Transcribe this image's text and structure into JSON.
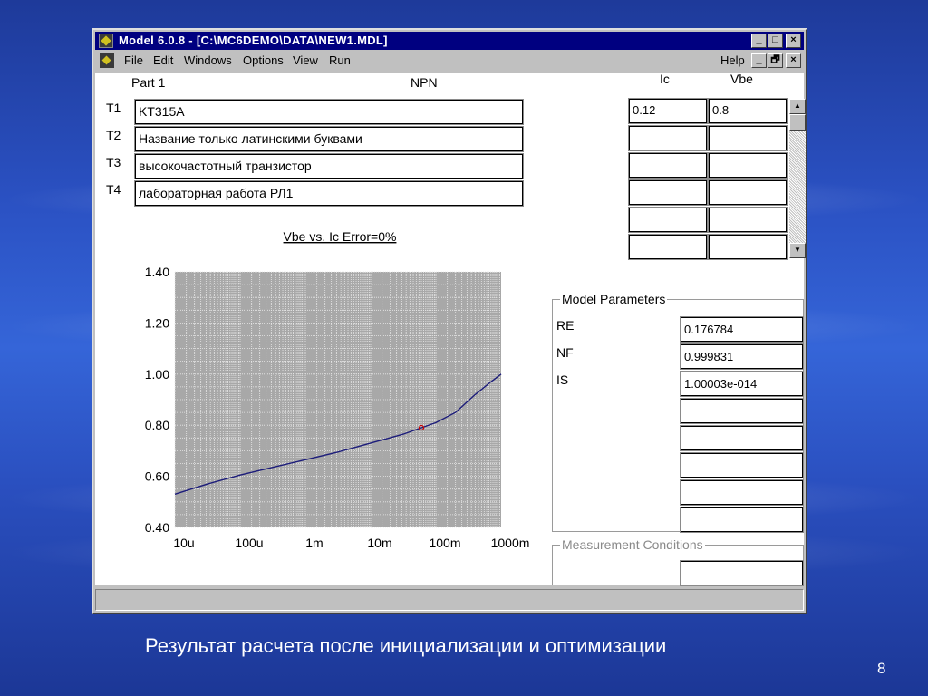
{
  "window": {
    "title": "Model 6.0.8 - [C:\\MC6DEMO\\DATA\\NEW1.MDL]",
    "controls": [
      "_",
      "□",
      "×"
    ]
  },
  "menu": {
    "items": [
      "File",
      "Edit",
      "Windows",
      "Options",
      "View",
      "Run"
    ],
    "help": "Help",
    "doc_controls": [
      "_",
      "🗗",
      "×"
    ]
  },
  "part": {
    "label": "Part 1",
    "type": "NPN"
  },
  "text_fields": [
    {
      "label": "T1",
      "value": "KT315A"
    },
    {
      "label": "T2",
      "value": "Название только латинскими буквами"
    },
    {
      "label": "T3",
      "value": "высокочастотный транзистор"
    },
    {
      "label": "T4",
      "value": "лабораторная работа РЛ1"
    }
  ],
  "data_table": {
    "headers": [
      "Ic",
      "Vbe"
    ],
    "rows": [
      [
        "0.12",
        "0.8"
      ],
      [
        "",
        ""
      ],
      [
        "",
        ""
      ],
      [
        "",
        ""
      ],
      [
        "",
        ""
      ],
      [
        "",
        ""
      ]
    ]
  },
  "model_parameters": {
    "title": "Model Parameters",
    "params": [
      {
        "name": "RE",
        "value": "0.176784"
      },
      {
        "name": "NF",
        "value": "0.999831"
      },
      {
        "name": "IS",
        "value": "1.00003e-014"
      },
      {
        "name": "",
        "value": ""
      },
      {
        "name": "",
        "value": ""
      },
      {
        "name": "",
        "value": ""
      },
      {
        "name": "",
        "value": ""
      },
      {
        "name": "",
        "value": ""
      }
    ]
  },
  "measurement_conditions": {
    "title": "Measurement Conditions",
    "values": [
      "",
      ""
    ]
  },
  "chart_data": {
    "type": "line",
    "title": "Vbe vs. Ic Error=0%",
    "x_scale": "log",
    "x_ticks": [
      "10u",
      "100u",
      "1m",
      "10m",
      "100m",
      "1000m"
    ],
    "y_ticks": [
      "1.40",
      "1.20",
      "1.00",
      "0.80",
      "0.60",
      "0.40"
    ],
    "xlim": [
      1e-05,
      1
    ],
    "ylim": [
      0.4,
      1.4
    ],
    "grid": true,
    "series": [
      {
        "color": "#1c1c7a",
        "points": [
          [
            1e-05,
            0.53
          ],
          [
            3.16e-05,
            0.57
          ],
          [
            0.0001,
            0.605
          ],
          [
            0.000316,
            0.635
          ],
          [
            0.001,
            0.665
          ],
          [
            0.00316,
            0.695
          ],
          [
            0.01,
            0.73
          ],
          [
            0.0316,
            0.765
          ],
          [
            0.1,
            0.81
          ],
          [
            0.2,
            0.85
          ],
          [
            0.4,
            0.92
          ],
          [
            0.7,
            0.97
          ],
          [
            1.0,
            1.0
          ]
        ]
      }
    ],
    "markers": [
      {
        "x": 0.06,
        "y": 0.79,
        "color": "#cc0000"
      }
    ]
  },
  "caption": "Результат расчета после инициализации и оптимизации",
  "page_number": "8"
}
